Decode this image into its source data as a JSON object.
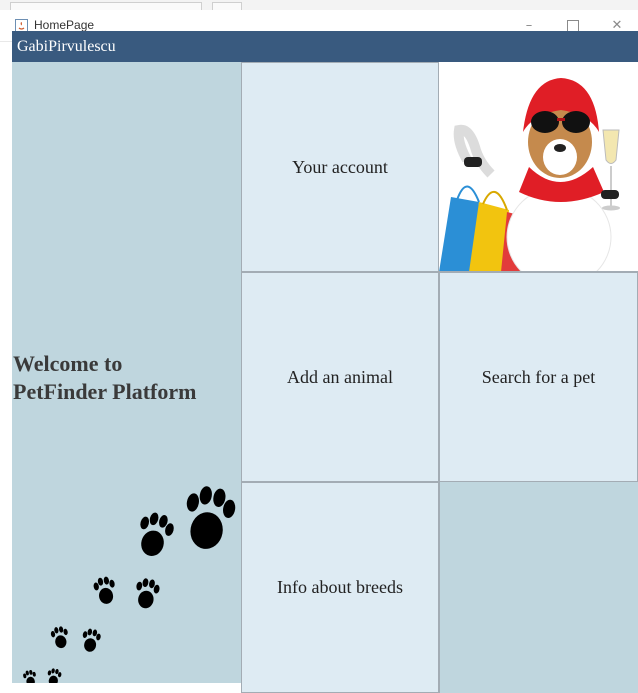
{
  "window": {
    "title": "HomePage",
    "controls": {
      "minimize": "–",
      "close": "✕"
    },
    "icon": "java-app-icon"
  },
  "header": {
    "username": "GabiPirvulescu"
  },
  "welcome": {
    "line1": "Welcome to",
    "line2": "PetFinder Platform"
  },
  "menu": {
    "your_account": "Your account",
    "add_animal": "Add an animal",
    "search_pet": "Search for a pet",
    "info_breeds": "Info about breeds"
  },
  "decor": {
    "paws": "paw-prints-illustration",
    "dog_image": "dog-with-shopping-bags-image"
  },
  "colors": {
    "header_bar": "#395a7f",
    "panel": "#bfd6de",
    "cell": "#deebf3"
  }
}
